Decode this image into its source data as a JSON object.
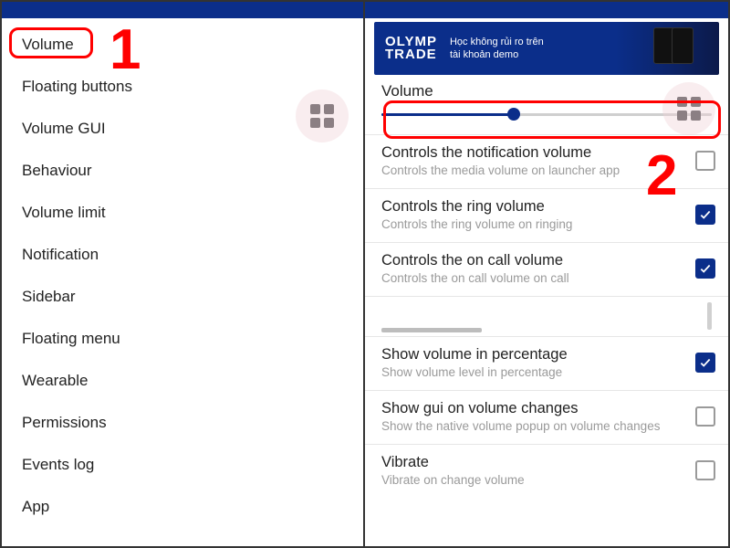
{
  "annotations": {
    "step1": "1",
    "step2": "2"
  },
  "left": {
    "menu": [
      "Volume",
      "Floating buttons",
      "Volume GUI",
      "Behaviour",
      "Volume limit",
      "Notification",
      "Sidebar",
      "Floating menu",
      "Wearable",
      "Permissions",
      "Events log",
      "App"
    ]
  },
  "right": {
    "ad": {
      "logo_l1": "OLYMP",
      "logo_l2": "TRADE",
      "text_l1": "Học không rủi ro trên",
      "text_l2": "tài khoản demo"
    },
    "volume_header": "Volume",
    "slider_percent": 40,
    "settings": [
      {
        "title": "Controls the notification volume",
        "sub": "Controls the media volume on launcher app",
        "checked": false
      },
      {
        "title": "Controls the ring volume",
        "sub": "Controls the ring volume on ringing",
        "checked": true
      },
      {
        "title": "Controls the on call volume",
        "sub": "Controls the on call volume on call",
        "checked": true
      },
      {
        "title": "Show volume in percentage",
        "sub": "Show volume level in percentage",
        "checked": true
      },
      {
        "title": "Show gui on volume changes",
        "sub": "Show the native volume popup on volume changes",
        "checked": false
      },
      {
        "title": "Vibrate",
        "sub": "Vibrate on change volume",
        "checked": false
      }
    ]
  }
}
